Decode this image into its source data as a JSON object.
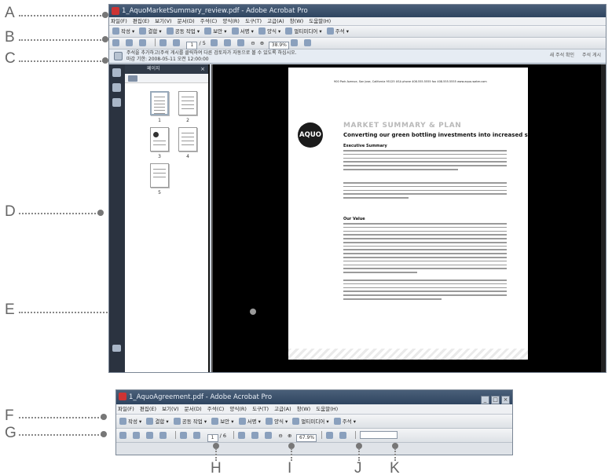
{
  "callouts": {
    "labels": [
      "A",
      "B",
      "C",
      "D",
      "E",
      "F",
      "G",
      "H",
      "I",
      "J",
      "K"
    ]
  },
  "main_window": {
    "title": "1_AquoMarketSummary_review.pdf - Adobe Acrobat Pro",
    "menu": [
      "파일(F)",
      "편집(E)",
      "보기(V)",
      "문서(D)",
      "주석(C)",
      "양식(R)",
      "도구(T)",
      "고급(A)",
      "창(W)",
      "도움말(H)"
    ],
    "task_toolbar": [
      "작성",
      "결합",
      "공동 작업",
      "보안",
      "서명",
      "양식",
      "멀티미디어",
      "주석"
    ],
    "nav_toolbar": {
      "page_current": "1",
      "page_total": "/ 5",
      "zoom": "38.9%"
    },
    "message_bar": {
      "line1": "주석을 추가하고(주석 게시를 클릭하여 다른 검토자가 자동으로 볼 수 있도록 하십시오.",
      "line2": "마감 기한: 2008-05-11 오전 12:00:00",
      "check_comments": "새 주석 확인",
      "publish_comments": "주석 게시"
    },
    "pages_panel": {
      "title": "페이지",
      "thumbnails": [
        "1",
        "2",
        "3",
        "4",
        "5"
      ]
    },
    "document": {
      "address_line": "900 Park Avenue, San Jose, California 95125 USA   phone 408.555.5555   fax 408.555.5555 www.aquo-water.com",
      "logo_text": "AQUO",
      "heading": "MARKET SUMMARY & PLAN",
      "subheading": "Converting our green bottling investments into increased sales",
      "section1": "Executive Summary",
      "section2": "Our Value"
    }
  },
  "second_window": {
    "title": "1_AquoAgreement.pdf - Adobe Acrobat Pro",
    "menu": [
      "파일(F)",
      "편집(E)",
      "보기(V)",
      "문서(D)",
      "주석(C)",
      "양식(R)",
      "도구(T)",
      "고급(A)",
      "창(W)",
      "도움말(H)"
    ],
    "task_toolbar": [
      "작성",
      "결합",
      "공동 작업",
      "보안",
      "서명",
      "양식",
      "멀티미디어",
      "주석"
    ],
    "nav_toolbar": {
      "page_current": "1",
      "page_total": "/ 6",
      "zoom": "67.9%"
    }
  }
}
